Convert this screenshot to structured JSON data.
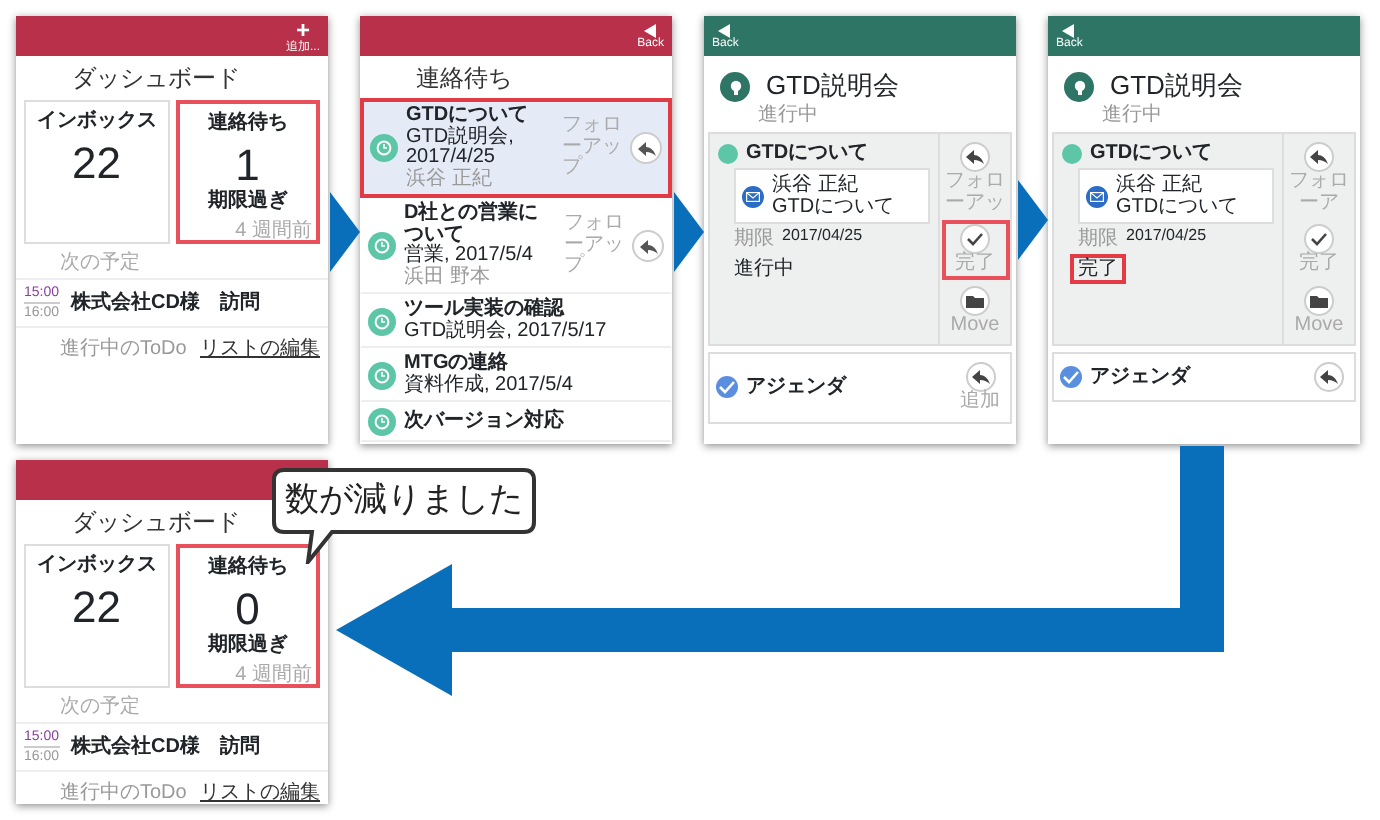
{
  "screens": [
    {
      "kind": "dashboard",
      "header_icon": "+",
      "header_label": "追加...",
      "title": "ダッシュボード",
      "cards": [
        {
          "label": "インボックス",
          "count": "22",
          "highlighted": false
        },
        {
          "label": "連絡待ち",
          "count": "1",
          "sub": "期限過ぎ",
          "note": "4 週間前",
          "highlighted": true
        }
      ],
      "section": "次の予定",
      "events": [
        {
          "start": "15:00",
          "end": "16:00",
          "title": "株式会社CD様　訪問"
        }
      ],
      "footer_label": "進行中のToDo",
      "footer_link": "リストの編集"
    },
    {
      "kind": "list",
      "back": "Back",
      "title": "連絡待ち",
      "items": [
        {
          "title": "GTDについて",
          "sub": "GTD説明会, 2017/4/25",
          "person": "浜谷 正紀",
          "action": "フォローアップ",
          "highlighted": true
        },
        {
          "title": "D社との営業について",
          "sub": "営業, 2017/5/4",
          "person": "浜田 野本",
          "action": "フォローアップ",
          "highlighted": false
        },
        {
          "title": "ツール実装の確認",
          "sub": "GTD説明会, 2017/5/17",
          "highlighted": false
        },
        {
          "title": "MTGの連絡",
          "sub": "資料作成, 2017/5/4",
          "highlighted": false
        },
        {
          "title": "次バージョン対応",
          "highlighted": false
        }
      ]
    },
    {
      "kind": "detail",
      "back": "Back",
      "title": "GTD説明会",
      "status": "進行中",
      "task": {
        "title": "GTDについて",
        "sender": "浜谷 正紀",
        "subject": "GTDについて",
        "date_label": "期限",
        "date": "2017/04/25",
        "state": "進行中",
        "highlighted": false
      },
      "actions": [
        {
          "kind": "reply",
          "label": "フォローアッ",
          "highlighted": false
        },
        {
          "kind": "check",
          "label": "完了",
          "highlighted": true
        },
        {
          "kind": "folder",
          "label": "Move",
          "highlighted": false
        }
      ],
      "next": {
        "title": "アジェンダ",
        "action": "追加"
      }
    },
    {
      "kind": "detail",
      "back": "Back",
      "title": "GTD説明会",
      "status": "進行中",
      "task": {
        "title": "GTDについて",
        "sender": "浜谷 正紀",
        "subject": "GTDについて",
        "date_label": "期限",
        "date": "2017/04/25",
        "state": "完了",
        "highlighted": true
      },
      "actions": [
        {
          "kind": "reply",
          "label": "フォローア",
          "highlighted": false
        },
        {
          "kind": "check",
          "label": "完了",
          "highlighted": false
        },
        {
          "kind": "folder",
          "label": "Move",
          "highlighted": false
        }
      ],
      "next": {
        "title": "アジェンダ"
      }
    },
    {
      "kind": "dashboard",
      "title": "ダッシュボード",
      "cards": [
        {
          "label": "インボックス",
          "count": "22",
          "highlighted": false
        },
        {
          "label": "連絡待ち",
          "count": "0",
          "sub": "期限過ぎ",
          "note": "4 週間前",
          "highlighted": true
        }
      ],
      "section": "次の予定",
      "events": [
        {
          "start": "15:00",
          "end": "16:00",
          "title": "株式会社CD様　訪問"
        }
      ],
      "footer_label": "進行中のToDo",
      "footer_link": "リストの編集",
      "callout": "数が減りました"
    }
  ]
}
